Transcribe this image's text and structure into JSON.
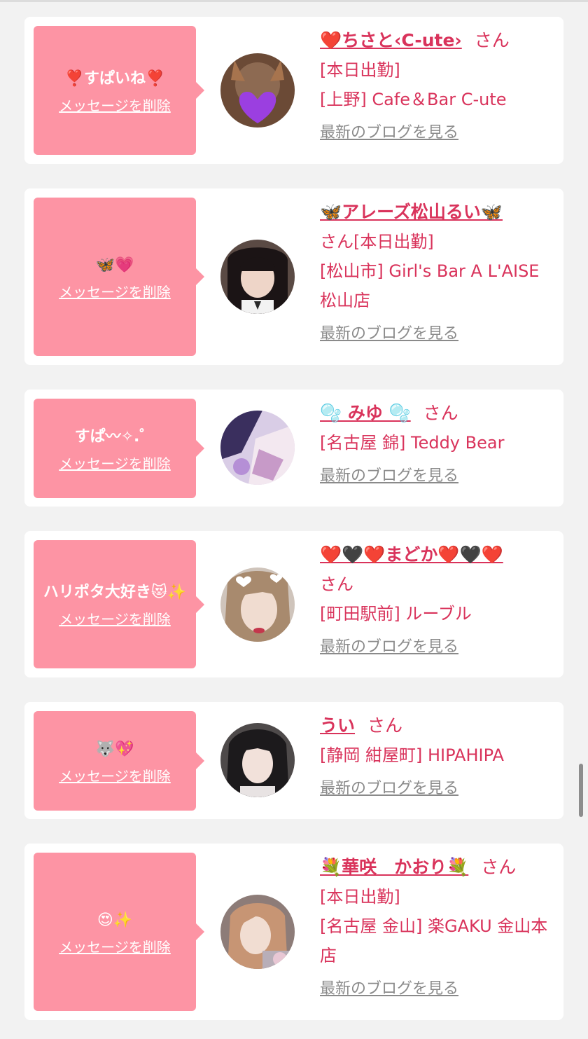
{
  "colors": {
    "accent": "#d9335b",
    "bubble": "#fd94a4",
    "link_gray": "#8a8a8a"
  },
  "common": {
    "delete_label": "メッセージを削除",
    "blog_label": "最新のブログを見る",
    "san": "さん"
  },
  "cards": [
    {
      "message": "❣️すぱいね❣️",
      "name": "❤️ちさと‹C-ute›",
      "status": "[本日出勤]",
      "shop": "[上野] Cafe＆Bar C-ute"
    },
    {
      "message": "🦋💗",
      "name": "🦋アレーズ松山るい🦋",
      "status": "[本日出勤]",
      "shop": "[松山市] Girl's Bar A L'AISE 松山店"
    },
    {
      "message": "すぱ〰︎✧.゜",
      "name": "🫧 みゆ 🫧",
      "status": "",
      "shop": "[名古屋 錦] Teddy Bear"
    },
    {
      "message": "ハリポタ大好き😻✨",
      "name": "❤️🖤❤️まどか❤️🖤❤️",
      "status": "",
      "shop": "[町田駅前] ルーブル"
    },
    {
      "message": "🐺💖",
      "name": "うい",
      "status": "",
      "shop": "[静岡 紺屋町] HIPAHIPA"
    },
    {
      "message": "😍✨",
      "name": "💐華咲　かおり💐",
      "status": "[本日出勤]",
      "shop": "[名古屋 金山] 楽GAKU 金山本店"
    }
  ]
}
